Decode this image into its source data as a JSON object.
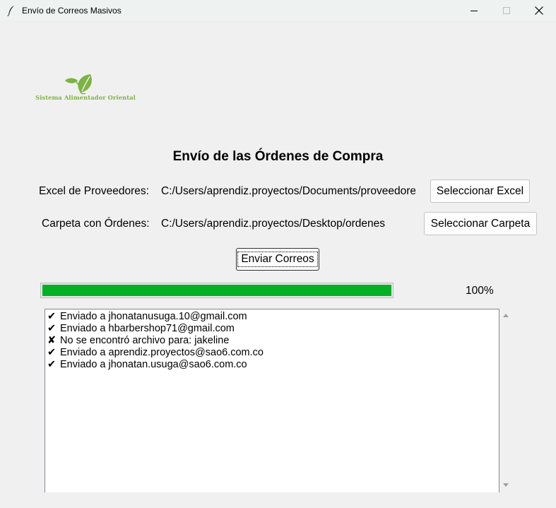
{
  "window": {
    "title": "Envío de Correos Masivos",
    "icon": "feather-icon"
  },
  "logo": {
    "text": "Sistema Alimentador Oriental",
    "icon": "leaf-icon",
    "color": "#7cb342"
  },
  "heading": "Envío de las Órdenes de Compra",
  "excel": {
    "label": "Excel de Proveedores:",
    "path": "C:/Users/aprendiz.proyectos/Documents/proveedores",
    "button": "Seleccionar Excel"
  },
  "folder": {
    "label": "Carpeta con Órdenes:",
    "path": "C:/Users/aprendiz.proyectos/Desktop/ordenes",
    "button": "Seleccionar Carpeta"
  },
  "send_button": "Enviar Correos",
  "progress": {
    "percent_label": "100%",
    "fraction": 1.0,
    "color": "#06b025"
  },
  "log": [
    {
      "mark": "✔",
      "text": "Enviado a jhonatanusuga.10@gmail.com"
    },
    {
      "mark": "✔",
      "text": "Enviado a hbarbershop71@gmail.com"
    },
    {
      "mark": "✘",
      "text": "No se encontró archivo para: jakeline"
    },
    {
      "mark": "✔",
      "text": "Enviado a aprendiz.proyectos@sao6.com.co"
    },
    {
      "mark": "✔",
      "text": "Enviado a jhonatan.usuga@sao6.com.co"
    }
  ]
}
